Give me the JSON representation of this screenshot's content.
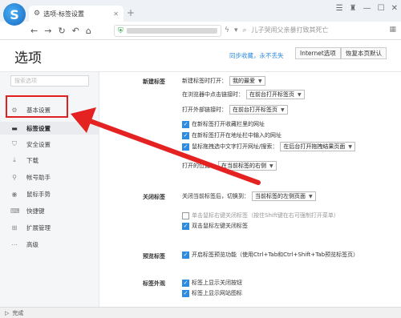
{
  "browser": {
    "logo": "S",
    "tab_title": "选项-标签设置",
    "tab_icon": "gear-icon",
    "news_text": "儿子哭闹父亲暴打致其死亡",
    "accent": "#2d8ce0"
  },
  "header": {
    "title": "选项",
    "sync_link": "同步收藏，永不丢失",
    "btn_internet": "Internet选项",
    "btn_restore": "恢复本页默认"
  },
  "sidebar": {
    "search_placeholder": "搜索选项",
    "items": [
      {
        "label": "基本设置",
        "icon": "gear-icon"
      },
      {
        "label": "标签设置",
        "icon": "tab-icon"
      },
      {
        "label": "安全设置",
        "icon": "shield-icon"
      },
      {
        "label": "下载",
        "icon": "download-icon"
      },
      {
        "label": "帐号助手",
        "icon": "key-icon"
      },
      {
        "label": "鼠标手势",
        "icon": "mouse-icon"
      },
      {
        "label": "快捷键",
        "icon": "keyboard-icon"
      },
      {
        "label": "扩展管理",
        "icon": "extension-icon"
      },
      {
        "label": "高级",
        "icon": "advanced-icon"
      }
    ]
  },
  "newtab": {
    "section": "新建标签",
    "open_label": "新建标签时打开：",
    "open_value": "我的最爱",
    "address_label": "在浏览器中点击链接时：",
    "address_value": "在前台打开标签页",
    "external_label": "打开外部链接时：",
    "external_value": "在前台打开标签页",
    "cb1": "在新标签打开收藏栏里的网址",
    "cb2": "在新标签打开在地址栏中输入的网址",
    "cb3": "鼠标拖拽选中文字打开网址/搜索：",
    "cb3_value": "在后台打开拖拽结果页面",
    "position_label": "打开的位置：",
    "position_value": "在当前标签的右侧"
  },
  "closetab": {
    "section": "关闭标签",
    "switch_label": "关闭当前标签后，切换到：",
    "switch_value": "当前标签的左侧页面",
    "cb1": "单击鼠标右键关闭标签（按住Shift键在右可强制打开菜单）",
    "cb2": "双击鼠标左键关闭标签"
  },
  "preview": {
    "section": "预览标签",
    "cb1": "开启标签预览功能（使用Ctrl+Tab和Ctrl+Shift+Tab预览标签页）"
  },
  "appearance": {
    "section": "标签外观",
    "cb1": "标签上显示关闭按钮",
    "cb2": "标签上显示网站图标"
  },
  "status": {
    "text": "完成"
  }
}
